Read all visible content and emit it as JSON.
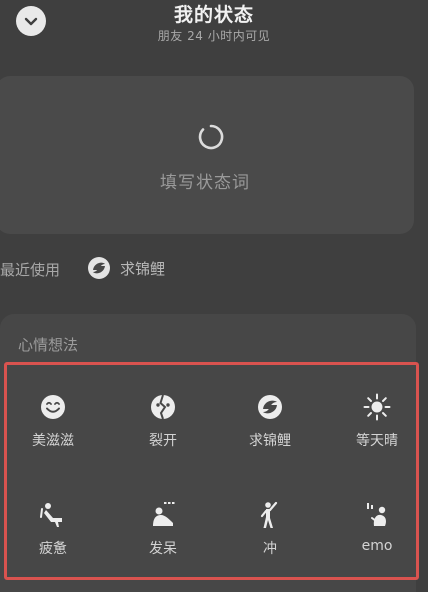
{
  "header": {
    "title": "我的状态",
    "subtitle": "朋友 24 小时内可见",
    "back_icon": "chevron-down-icon"
  },
  "status_card": {
    "placeholder": "填写状态词",
    "icon": "refresh-spinner-icon"
  },
  "recent": {
    "label": "最近使用",
    "items": [
      {
        "label": "求锦鲤",
        "icon": "koi-fish-icon"
      }
    ]
  },
  "mood": {
    "section_label": "心情想法",
    "highlight_color": "#d9534f",
    "items": [
      {
        "label": "美滋滋",
        "icon": "smiley-face-icon"
      },
      {
        "label": "裂开",
        "icon": "cracked-face-icon"
      },
      {
        "label": "求锦鲤",
        "icon": "koi-fish-icon"
      },
      {
        "label": "等天晴",
        "icon": "sun-icon"
      },
      {
        "label": "疲惫",
        "icon": "tired-person-icon"
      },
      {
        "label": "发呆",
        "icon": "daydream-person-icon"
      },
      {
        "label": "冲",
        "icon": "rush-person-icon"
      },
      {
        "label": "emo",
        "icon": "emo-person-icon"
      }
    ]
  }
}
